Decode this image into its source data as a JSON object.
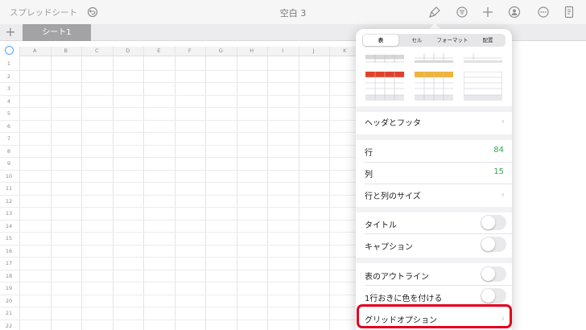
{
  "toolbar": {
    "back_label": "スプレッドシート",
    "doc_title": "空白 3",
    "icons": [
      "undo-icon",
      "brush-icon",
      "format-icon",
      "add-icon",
      "collaborate-icon",
      "more-icon",
      "document-icon"
    ]
  },
  "sheets": {
    "add_label": "+",
    "tabs": [
      {
        "label": "シート1"
      }
    ]
  },
  "grid": {
    "columns": [
      "A",
      "B",
      "C",
      "D",
      "E",
      "F",
      "G",
      "H",
      "I",
      "J",
      "K"
    ],
    "rows": [
      "1",
      "2",
      "3",
      "4",
      "5",
      "6",
      "7",
      "8",
      "9",
      "10",
      "11",
      "12",
      "13",
      "14",
      "15",
      "16",
      "17",
      "18",
      "19",
      "20",
      "21",
      "22"
    ]
  },
  "popover": {
    "tabs": [
      {
        "label": "表",
        "active": true
      },
      {
        "label": "セル",
        "active": false
      },
      {
        "label": "フォーマット",
        "active": false
      },
      {
        "label": "配置",
        "active": false
      }
    ],
    "header_footer_label": "ヘッダとフッタ",
    "rows_label": "行",
    "rows_value": "84",
    "columns_label": "列",
    "columns_value": "15",
    "size_label": "行と列のサイズ",
    "title_label": "タイトル",
    "caption_label": "キャプション",
    "outline_label": "表のアウトライン",
    "alternate_label": "1行おきに色を付ける",
    "grid_options_label": "グリッドオプション",
    "accent_colors": {
      "red": "#e1412b",
      "yellow": "#efb438",
      "value_green": "#34a853",
      "highlight": "#e3001b"
    }
  }
}
